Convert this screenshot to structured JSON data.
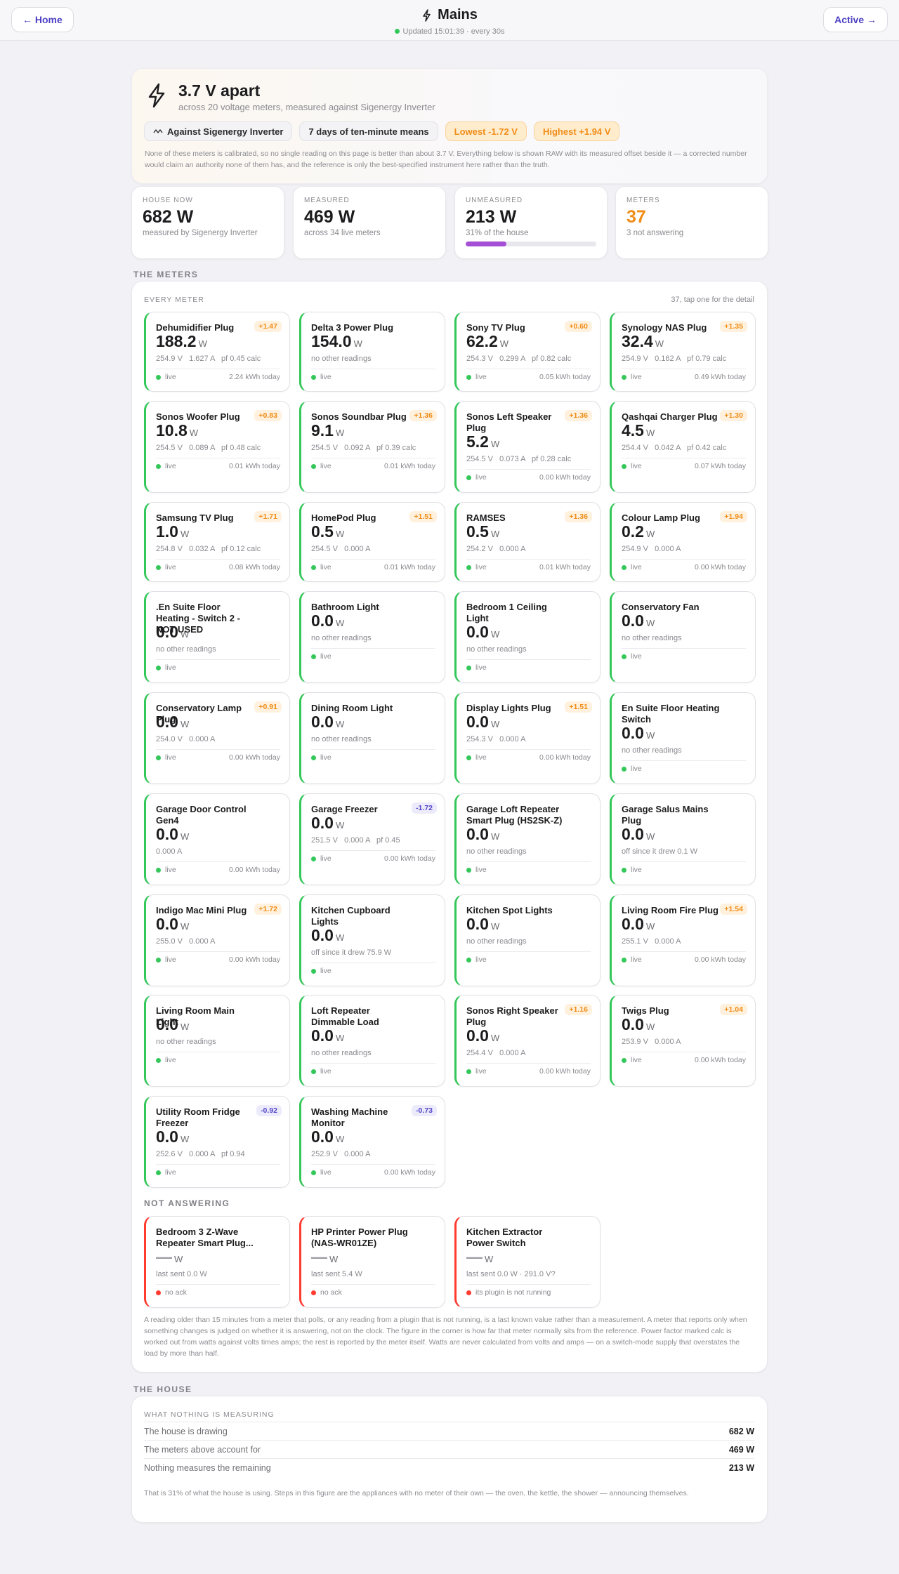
{
  "topbar": {
    "home_label": "← Home",
    "title": "Mains",
    "updated": "Updated 15:01:39 · every 30s",
    "active_label": "Active →"
  },
  "hero": {
    "title": "3.7 V apart",
    "subtitle": "across 20 voltage meters, measured against Sigenergy Inverter",
    "chips": [
      "Against Sigenergy Inverter",
      "7 days of ten-minute means",
      "Lowest -1.72 V",
      "Highest +1.94 V"
    ],
    "note": "None of these meters is calibrated, so no single reading on this page is better than about 3.7 V. Everything below is shown RAW with its measured offset beside it — a corrected number would claim an authority none of them has, and the reference is only the best-specified instrument here rather than the truth."
  },
  "stats": [
    {
      "label": "HOUSE NOW",
      "value": "682 W",
      "sub": "measured by Sigenergy Inverter"
    },
    {
      "label": "MEASURED",
      "value": "469 W",
      "sub": "across 34 live meters"
    },
    {
      "label": "UNMEASURED",
      "value": "213 W",
      "sub": "31% of the house",
      "progress": 31
    },
    {
      "label": "METERS",
      "value": "37",
      "sub": "3 not answering"
    }
  ],
  "colors": {
    "accent": "#4b3fc4",
    "live": "#34c759",
    "dead": "#ff3b30",
    "warn": "#f08d18",
    "progress": "#a44fd6"
  },
  "section_meters": "THE METERS",
  "meters_panel": {
    "head": "EVERY METER",
    "count": "37, tap one for the detail",
    "not_answering_label": "NOT ANSWERING",
    "note": "A reading older than 15 minutes from a meter that polls, or any reading from a plugin that is not running, is a last known value rather than a measurement. A meter that reports only when something changes is judged on whether it is answering, not on the clock. The figure in the corner is how far that meter normally sits from the reference. Power factor marked calc is worked out from watts against volts times amps; the rest is reported by the meter itself. Watts are never calculated from volts and amps — on a switch-mode supply that overstates the load by more than half."
  },
  "unit_w": "W",
  "meters": [
    {
      "name": "Dehumidifier Plug",
      "offset": "+1.47",
      "value": "188.2",
      "detail": "254.9 V   1.627 A   pf 0.45 calc",
      "status": "live",
      "today": "2.24 kWh today"
    },
    {
      "name": "Delta 3 Power Plug",
      "offset": "",
      "value": "154.0",
      "detail": "no other readings",
      "status": "live",
      "today": ""
    },
    {
      "name": "Sony TV Plug",
      "offset": "+0.60",
      "value": "62.2",
      "detail": "254.3 V   0.299 A   pf 0.82 calc",
      "status": "live",
      "today": "0.05 kWh today"
    },
    {
      "name": "Synology NAS Plug",
      "offset": "+1.35",
      "value": "32.4",
      "detail": "254.9 V   0.162 A   pf 0.79 calc",
      "status": "live",
      "today": "0.49 kWh today"
    },
    {
      "name": "Sonos Woofer Plug",
      "offset": "+0.83",
      "value": "10.8",
      "detail": "254.5 V   0.089 A   pf 0.48 calc",
      "status": "live",
      "today": "0.01 kWh today"
    },
    {
      "name": "Sonos Soundbar Plug",
      "offset": "+1.36",
      "value": "9.1",
      "detail": "254.5 V   0.092 A   pf 0.39 calc",
      "status": "live",
      "today": "0.01 kWh today"
    },
    {
      "name": "Sonos Left Speaker Plug",
      "offset": "+1.36",
      "value": "5.2",
      "detail": "254.5 V   0.073 A   pf 0.28 calc",
      "status": "live",
      "today": "0.00 kWh today"
    },
    {
      "name": "Qashqai Charger Plug",
      "offset": "+1.30",
      "value": "4.5",
      "detail": "254.4 V   0.042 A   pf 0.42 calc",
      "status": "live",
      "today": "0.07 kWh today"
    },
    {
      "name": "Samsung TV Plug",
      "offset": "+1.71",
      "value": "1.0",
      "detail": "254.8 V   0.032 A   pf 0.12 calc",
      "status": "live",
      "today": "0.08 kWh today"
    },
    {
      "name": "HomePod Plug",
      "offset": "+1.51",
      "value": "0.5",
      "detail": "254.5 V   0.000 A",
      "status": "live",
      "today": "0.01 kWh today"
    },
    {
      "name": "RAMSES",
      "offset": "+1.36",
      "value": "0.5",
      "detail": "254.2 V   0.000 A",
      "status": "live",
      "today": "0.01 kWh today"
    },
    {
      "name": "Colour Lamp Plug",
      "offset": "+1.94",
      "value": "0.2",
      "detail": "254.9 V   0.000 A",
      "status": "live",
      "today": "0.00 kWh today"
    },
    {
      "name": ".En Suite Floor Heating - Switch 2 - NOT USED",
      "offset": "",
      "value": "0.0",
      "detail": "no other readings",
      "status": "live",
      "today": ""
    },
    {
      "name": "Bathroom Light",
      "offset": "",
      "value": "0.0",
      "detail": "no other readings",
      "status": "live",
      "today": ""
    },
    {
      "name": "Bedroom 1 Ceiling Light",
      "offset": "",
      "value": "0.0",
      "detail": "no other readings",
      "status": "live",
      "today": ""
    },
    {
      "name": "Conservatory Fan",
      "offset": "",
      "value": "0.0",
      "detail": "no other readings",
      "status": "live",
      "today": ""
    },
    {
      "name": "Conservatory Lamp Plug",
      "offset": "+0.91",
      "value": "0.0",
      "detail": "254.0 V   0.000 A",
      "status": "live",
      "today": "0.00 kWh today"
    },
    {
      "name": "Dining Room Light",
      "offset": "",
      "value": "0.0",
      "detail": "no other readings",
      "status": "live",
      "today": ""
    },
    {
      "name": "Display Lights Plug",
      "offset": "+1.51",
      "value": "0.0",
      "detail": "254.3 V   0.000 A",
      "status": "live",
      "today": "0.00 kWh today"
    },
    {
      "name": "En Suite Floor Heating Switch",
      "offset": "",
      "value": "0.0",
      "detail": "no other readings",
      "status": "live",
      "today": ""
    },
    {
      "name": "Garage Door Control Gen4",
      "offset": "",
      "value": "0.0",
      "detail": "0.000 A",
      "status": "live",
      "today": "0.00 kWh today"
    },
    {
      "name": "Garage Freezer",
      "offset": "-1.72",
      "value": "0.0",
      "detail": "251.5 V   0.000 A   pf 0.45",
      "status": "live",
      "today": "0.00 kWh today"
    },
    {
      "name": "Garage Loft Repeater Smart Plug (HS2SK-Z)",
      "offset": "",
      "value": "0.0",
      "detail": "no other readings",
      "status": "live",
      "today": ""
    },
    {
      "name": "Garage Salus Mains Plug",
      "offset": "",
      "value": "0.0",
      "detail": "off since it drew 0.1 W",
      "status": "live",
      "today": ""
    },
    {
      "name": "Indigo Mac Mini Plug",
      "offset": "+1.72",
      "value": "0.0",
      "detail": "255.0 V   0.000 A",
      "status": "live",
      "today": "0.00 kWh today"
    },
    {
      "name": "Kitchen Cupboard Lights",
      "offset": "",
      "value": "0.0",
      "detail": "off since it drew 75.9 W",
      "status": "live",
      "today": ""
    },
    {
      "name": "Kitchen Spot Lights",
      "offset": "",
      "value": "0.0",
      "detail": "no other readings",
      "status": "live",
      "today": ""
    },
    {
      "name": "Living Room Fire Plug",
      "offset": "+1.54",
      "value": "0.0",
      "detail": "255.1 V   0.000 A",
      "status": "live",
      "today": "0.00 kWh today"
    },
    {
      "name": "Living Room Main Light",
      "offset": "",
      "value": "0.0",
      "detail": "no other readings",
      "status": "live",
      "today": ""
    },
    {
      "name": "Loft Repeater Dimmable Load",
      "offset": "",
      "value": "0.0",
      "detail": "no other readings",
      "status": "live",
      "today": ""
    },
    {
      "name": "Sonos Right Speaker Plug",
      "offset": "+1.16",
      "value": "0.0",
      "detail": "254.4 V   0.000 A",
      "status": "live",
      "today": "0.00 kWh today"
    },
    {
      "name": "Twigs Plug",
      "offset": "+1.04",
      "value": "0.0",
      "detail": "253.9 V   0.000 A",
      "status": "live",
      "today": "0.00 kWh today"
    },
    {
      "name": "Utility Room Fridge Freezer",
      "offset": "-0.92",
      "value": "0.0",
      "detail": "252.6 V   0.000 A   pf 0.94",
      "status": "live",
      "today": ""
    },
    {
      "name": "Washing Machine Monitor",
      "offset": "-0.73",
      "value": "0.0",
      "detail": "252.9 V   0.000 A",
      "status": "live",
      "today": "0.00 kWh today"
    }
  ],
  "not_answering": [
    {
      "name": "Bedroom 3 Z-Wave Repeater Smart Plug...",
      "offset": "",
      "value": "—",
      "detail": "last sent 0.0 W",
      "status": "no ack",
      "today": ""
    },
    {
      "name": "HP Printer Power Plug (NAS-WR01ZE)",
      "offset": "",
      "value": "—",
      "detail": "last sent 5.4 W",
      "status": "no ack",
      "today": ""
    },
    {
      "name": "Kitchen Extractor Power Switch",
      "offset": "",
      "value": "—",
      "detail": "last sent 0.0 W · 291.0 V?",
      "status": "its plugin is not running",
      "today": ""
    }
  ],
  "section_house": "THE HOUSE",
  "house": {
    "head": "WHAT NOTHING IS MEASURING",
    "rows": [
      {
        "label": "The house is drawing",
        "value": "682 W"
      },
      {
        "label": "The meters above account for",
        "value": "469 W"
      },
      {
        "label": "Nothing measures the remaining",
        "value": "213 W"
      }
    ],
    "note": "That is 31% of what the house is using. Steps in this figure are the appliances with no meter of their own — the oven, the kettle, the shower — announcing themselves."
  }
}
